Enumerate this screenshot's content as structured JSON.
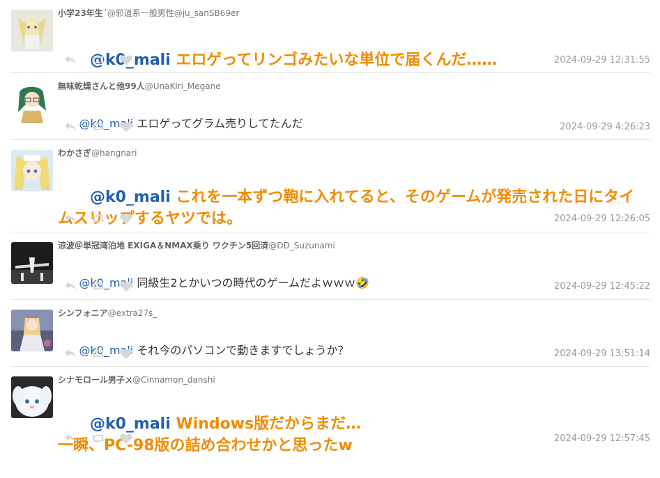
{
  "tweets": [
    {
      "name": "小学23年生´",
      "handle": "@邪道系一般男性@ju_sanSB69er",
      "mention": "@k0_mali",
      "body": " エロゲってリンゴみたいな単位で届くんだ……",
      "time": "2024-09-29 12:31:55",
      "style": "big"
    },
    {
      "name": "無味乾燥さんと他99人",
      "handle": "@UnaKiri_Megane",
      "mention": "@k0_mali",
      "body": " エロゲってグラム売りしてたんだ",
      "time": "2024-09-29 4:26:23",
      "style": "normal"
    },
    {
      "name": "わかさぎ",
      "handle": "@hangnari",
      "mention": "@k0_mali",
      "body": " これを一本ずつ鞄に入れてると、そのゲームが発売された日にタイムスリップするヤツでは。",
      "time": "2024-09-29 12:26:05",
      "style": "big"
    },
    {
      "name": "涼波＠単冠湾泊地 EXIGA＆NMAX乗り ワクチン5回済",
      "handle": "@DD_Suzunami",
      "mention": "@k0_mali",
      "body": " 同級生2とかいつの時代のゲームだよｗｗｗ🤣",
      "time": "2024-09-29 12:45:22",
      "style": "normal"
    },
    {
      "name": "シンフォニア",
      "handle": "@extra27s_",
      "mention": "@k0_mali",
      "body": " それ今のパソコンで動きますでしょうか？",
      "time": "2024-09-29 13:51:14",
      "style": "normal"
    },
    {
      "name": "シナモロール男子",
      "handle": "@Cinnamon_danshi",
      "mention": "@k0_mali",
      "body": " Windows版だからまだ…\n一瞬、PC-98版の詰め合わせかと思ったw",
      "time": "2024-09-29 12:57:45",
      "style": "big"
    }
  ],
  "icons": {
    "reply": "reply-icon",
    "retweet": "retweet-icon",
    "like": "heart-icon"
  },
  "colors": {
    "mention": "#1f5fae",
    "highlight": "#f08c00",
    "action_icon": "#d8d8d8"
  }
}
